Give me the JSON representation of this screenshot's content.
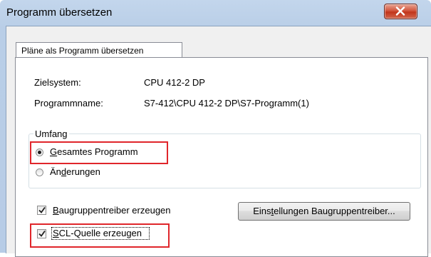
{
  "window": {
    "title": "Programm übersetzen"
  },
  "tab": {
    "label": "Pläne als Programm übersetzen"
  },
  "info": {
    "target_label": "Zielsystem:",
    "target_value": "CPU 412-2 DP",
    "program_label": "Programmname:",
    "program_value": "S7-412\\CPU 412-2 DP\\S7-Programm(1)"
  },
  "scope": {
    "legend": "Umfang",
    "option_full": {
      "mnemonic": "G",
      "rest": "esamtes Programm",
      "selected": true
    },
    "option_changes": {
      "pre": "Än",
      "mnemonic": "d",
      "rest": "erungen",
      "selected": false
    }
  },
  "driver": {
    "mnemonic": "B",
    "rest": "augruppentreiber erzeugen",
    "checked": true,
    "settings_pre": "Eins",
    "settings_mnemonic": "t",
    "settings_rest": "ellungen Baugruppentreiber..."
  },
  "scl": {
    "mnemonic": "S",
    "rest": "CL-Quelle erzeugen",
    "checked": true
  },
  "colors": {
    "highlight": "#e0262b",
    "close_button": "#c1351b"
  }
}
